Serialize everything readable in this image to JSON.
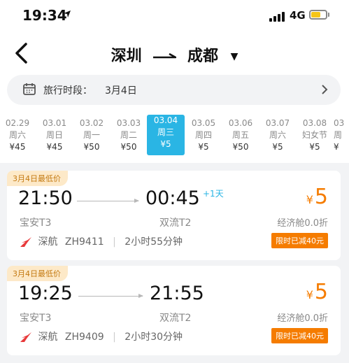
{
  "status": {
    "time": "19:34",
    "network": "4G"
  },
  "header": {
    "origin": "深圳",
    "destination": "成都"
  },
  "date_selector": {
    "label": "旅行时段：",
    "value": "3月4日"
  },
  "days": [
    {
      "date": "02.29",
      "weekday": "周六",
      "price": "¥45"
    },
    {
      "date": "03.01",
      "weekday": "周日",
      "price": "¥45"
    },
    {
      "date": "03.02",
      "weekday": "周一",
      "price": "¥50"
    },
    {
      "date": "03.03",
      "weekday": "周二",
      "price": "¥50"
    },
    {
      "date": "03.04",
      "weekday": "周三",
      "price": "¥5",
      "selected": true
    },
    {
      "date": "03.05",
      "weekday": "周四",
      "price": "¥5"
    },
    {
      "date": "03.06",
      "weekday": "周五",
      "price": "¥50"
    },
    {
      "date": "03.07",
      "weekday": "周六",
      "price": "¥5"
    },
    {
      "date": "03.08",
      "weekday": "妇女节",
      "price": "¥5"
    },
    {
      "date": "03",
      "weekday": "周",
      "price": "¥"
    }
  ],
  "flights": [
    {
      "badge": "3月4日最低价",
      "dep_time": "21:50",
      "arr_time": "00:45",
      "plus_day": "+1天",
      "dep_terminal": "宝安T3",
      "arr_terminal": "双流T2",
      "currency": "¥",
      "price": "5",
      "cabin": "经济舱0.0折",
      "airline": "深航",
      "flight_no": "ZH9411",
      "duration": "2小时55分钟",
      "discount": "限时已减40元"
    },
    {
      "badge": "3月4日最低价",
      "dep_time": "19:25",
      "arr_time": "21:55",
      "plus_day": "",
      "dep_terminal": "宝安T3",
      "arr_terminal": "双流T2",
      "currency": "¥",
      "price": "5",
      "cabin": "经济舱0.0折",
      "airline": "深航",
      "flight_no": "ZH9409",
      "duration": "2小时30分钟",
      "discount": "限时已减40元"
    }
  ],
  "colors": {
    "accent": "#2ab5e4",
    "price": "#f57c00",
    "badge_bg": "#fde9c8",
    "airline_logo": "#e8393a"
  }
}
